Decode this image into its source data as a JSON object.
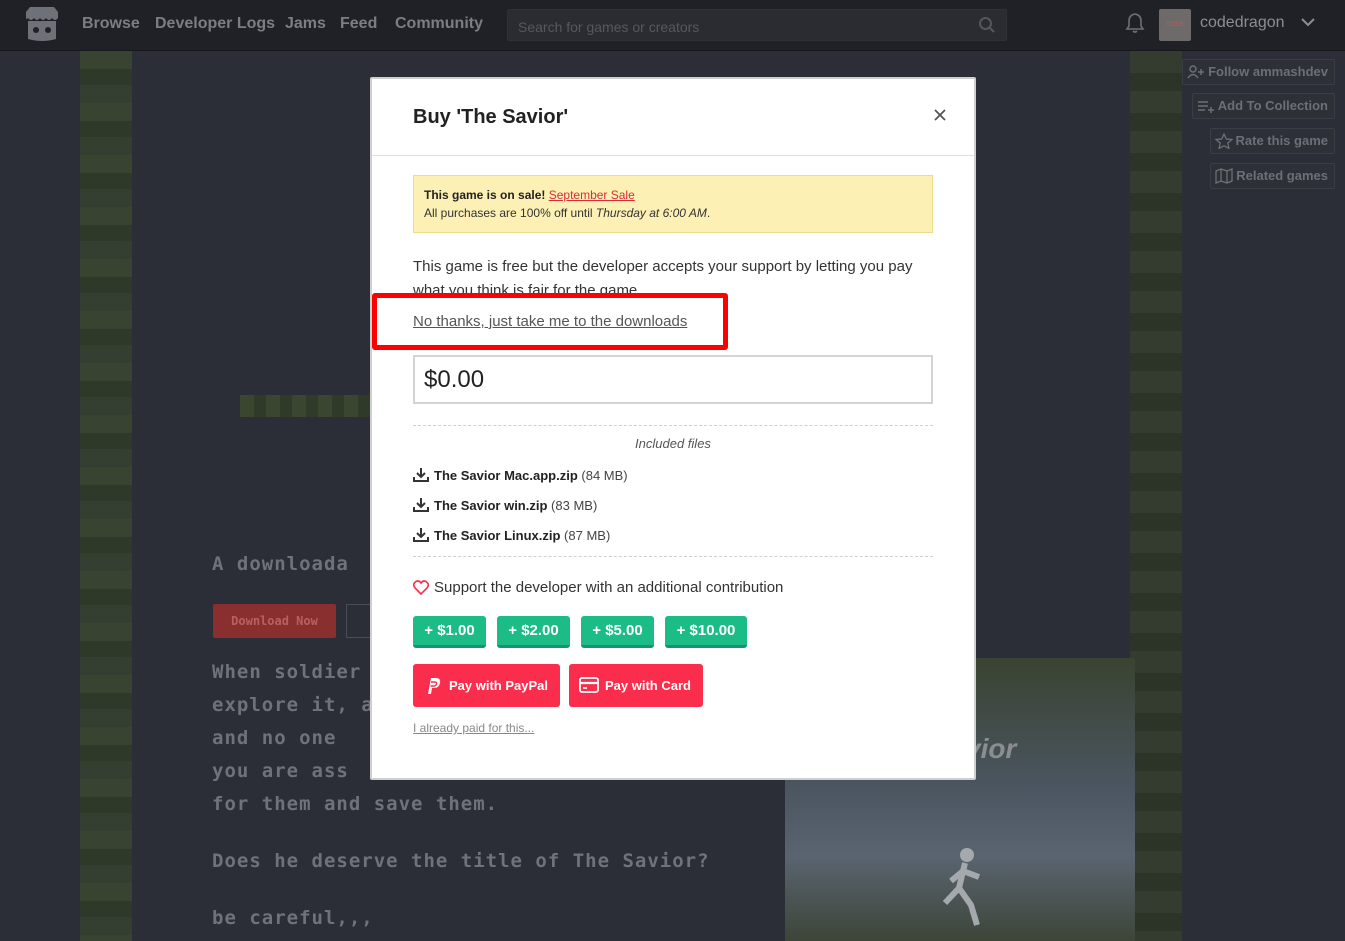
{
  "nav": {
    "links": [
      "Browse",
      "Developer Logs",
      "Jams",
      "Feed",
      "Community"
    ],
    "search_placeholder": "Search for games or creators",
    "username": "codedragon",
    "avatar_text": "CODE DRAGON"
  },
  "side_actions": [
    "Follow ammashdev",
    "Add To Collection",
    "Rate this game",
    "Related games"
  ],
  "background": {
    "tagline": "A downloada",
    "download_label": "Download Now",
    "desc_lines": [
      "When soldier",
      "explore it, ar",
      "and no one",
      "you are ass",
      "for them and save them."
    ],
    "question": "Does he deserve the title of The Savior?",
    "careful": "be careful,,,",
    "cover_title": "vior"
  },
  "modal": {
    "title": "Buy 'The Savior'",
    "sale": {
      "prefix": "This game is on sale!",
      "link": "September Sale",
      "line2_prefix": "All purchases are 100% off until",
      "line2_when": "Thursday at 6:00 AM",
      "line2_suffix": "."
    },
    "free_text": "This game is free but the developer accepts your support by letting you pay what you think is fair for the game.",
    "no_thanks": "No thanks, just take me to the downloads",
    "price_value": "$0.00",
    "included_label": "Included files",
    "files": [
      {
        "name": "The Savior Mac.app.zip",
        "size": "(84 MB)"
      },
      {
        "name": "The Savior win.zip",
        "size": "(83 MB)"
      },
      {
        "name": "The Savior Linux.zip",
        "size": "(87 MB)"
      }
    ],
    "support_text": "Support the developer with an additional contribution",
    "tips": [
      "+ $1.00",
      "+ $2.00",
      "+ $5.00",
      "+ $10.00"
    ],
    "pay_paypal": "Pay with PayPal",
    "pay_card": "Pay with Card",
    "already_paid": "I already paid for this..."
  },
  "colors": {
    "accent": "#fa2d4c",
    "tip_green": "#1bbc85",
    "highlight": "#ff0000",
    "sale_bg": "#fcf0b4"
  }
}
